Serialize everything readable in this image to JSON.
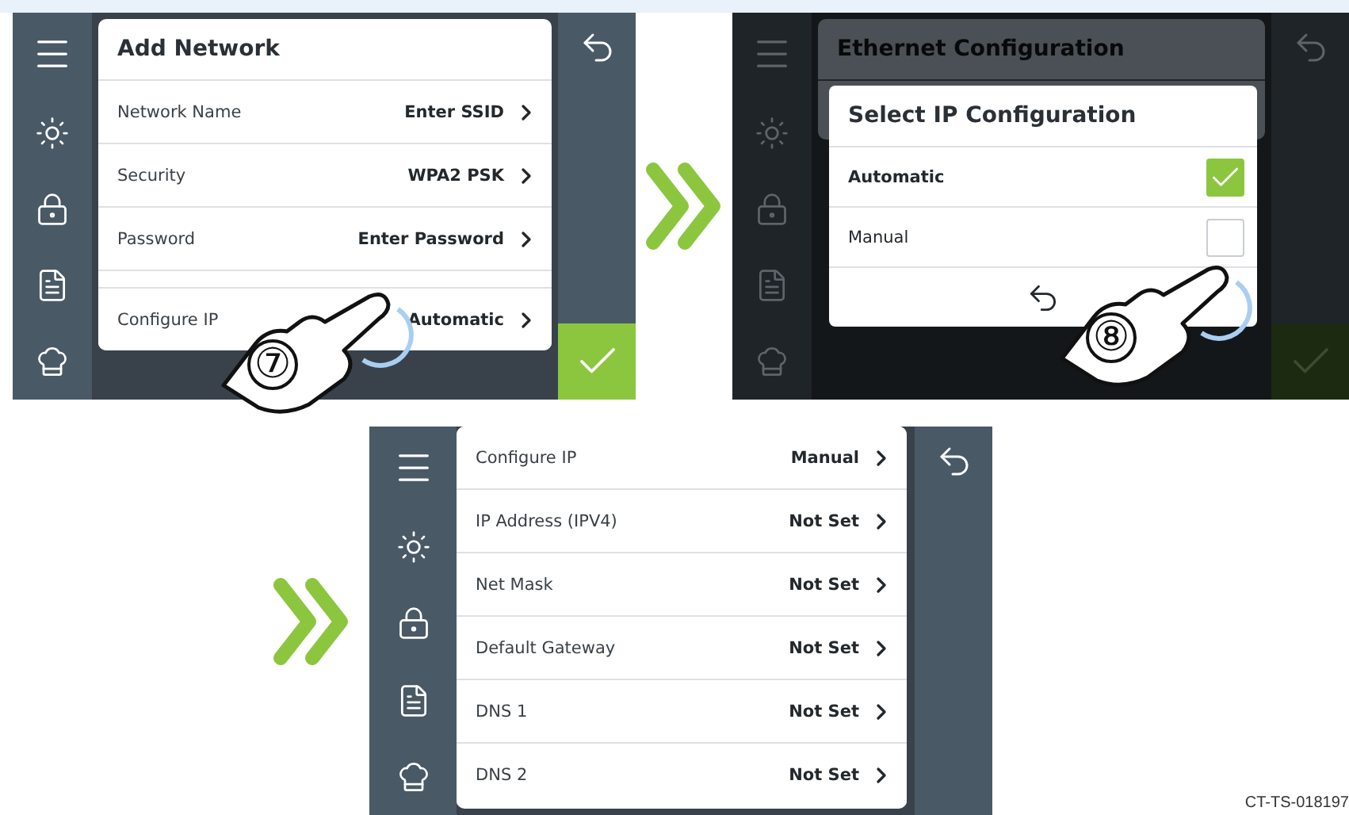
{
  "screens": [
    {
      "kind": "form",
      "title": "Add Network",
      "rows": [
        {
          "label": "Network Name",
          "value": "Enter SSID"
        },
        {
          "label": "Security",
          "value": "WPA2 PSK"
        },
        {
          "label": "Password",
          "value": "Enter Password"
        },
        {
          "label": "Configure IP",
          "value": "Automatic"
        }
      ],
      "step": "⑦"
    },
    {
      "kind": "dialog",
      "background_title": "Ethernet Configuration",
      "dialog_title": "Select IP Configuration",
      "options": [
        {
          "label": "Automatic",
          "selected": true
        },
        {
          "label": "Manual",
          "selected": false
        }
      ],
      "step": "⑧"
    },
    {
      "kind": "list",
      "rows": [
        {
          "label": "Configure IP",
          "value": "Manual"
        },
        {
          "label": "IP Address (IPV4)",
          "value": "Not Set"
        },
        {
          "label": "Net Mask",
          "value": "Not Set"
        },
        {
          "label": "Default Gateway",
          "value": "Not Set"
        },
        {
          "label": "DNS 1",
          "value": "Not Set"
        },
        {
          "label": "DNS 2",
          "value": "Not Set"
        }
      ]
    }
  ],
  "caption": "CT-TS-018197"
}
